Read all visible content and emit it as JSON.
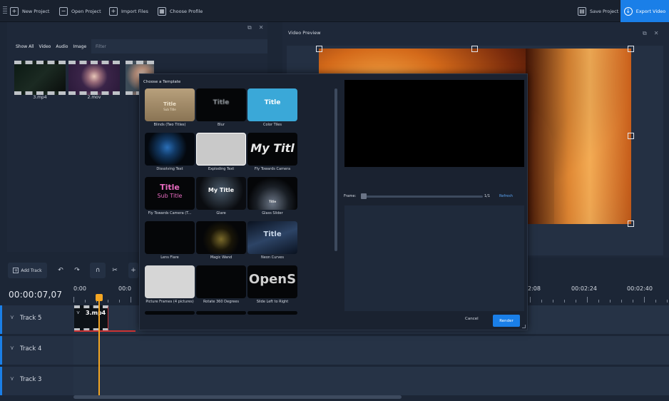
{
  "toolbar": {
    "new_project": "New Project",
    "open_project": "Open Project",
    "import_files": "Import Files",
    "choose_profile": "Choose Profile",
    "save_project": "Save Project",
    "export_video": "Export Video"
  },
  "media": {
    "filters": [
      "Show All",
      "Video",
      "Audio",
      "Image"
    ],
    "filter_placeholder": "Filter",
    "files": [
      {
        "name": "3.mp4"
      },
      {
        "name": "2.mov"
      }
    ]
  },
  "preview": {
    "title": "Video Preview"
  },
  "timeline": {
    "add_track": "Add Track",
    "timecode": "00:00:07,07",
    "ruler": [
      "0:00",
      "00:0",
      "2:08",
      "00:02:24",
      "00:02:40"
    ],
    "tracks": [
      {
        "name": "Track 5"
      },
      {
        "name": "Track 4"
      },
      {
        "name": "Track 3"
      }
    ],
    "clip_label": "3.mp4"
  },
  "dialog": {
    "title": "Choose a Template",
    "templates": [
      {
        "label": "Blinds (Two Titles)",
        "thumb_text": "Title",
        "thumb_sub": "Sub Title"
      },
      {
        "label": "Blur",
        "thumb_text": "Title"
      },
      {
        "label": "Color Tiles",
        "thumb_text": "Title"
      },
      {
        "label": "Dissolving Text"
      },
      {
        "label": "Exploding Text"
      },
      {
        "label": "Fly Towards Camera",
        "thumb_text": "My Titl"
      },
      {
        "label": "Fly Towards Camera (T...",
        "thumb_text": "Title",
        "thumb_sub": "Sub Title"
      },
      {
        "label": "Glare",
        "thumb_text": "My Title"
      },
      {
        "label": "Glass Slider",
        "thumb_text": "Title"
      },
      {
        "label": "Lens Flare"
      },
      {
        "label": "Magic Wand"
      },
      {
        "label": "Neon Curves",
        "thumb_text": "Title"
      },
      {
        "label": "Picture Frames (4 pictures)"
      },
      {
        "label": "Rotate 360 Degrees"
      },
      {
        "label": "Slide Left to Right",
        "thumb_text": "OpenS"
      }
    ],
    "frame_label": "Frame:",
    "frame_count": "1/1",
    "refresh": "Refresh",
    "cancel": "Cancel",
    "render": "Render"
  },
  "colors": {
    "accent": "#1a7fe8",
    "playhead": "#f5a623",
    "panel": "#1e2839",
    "background": "#1c2636"
  }
}
